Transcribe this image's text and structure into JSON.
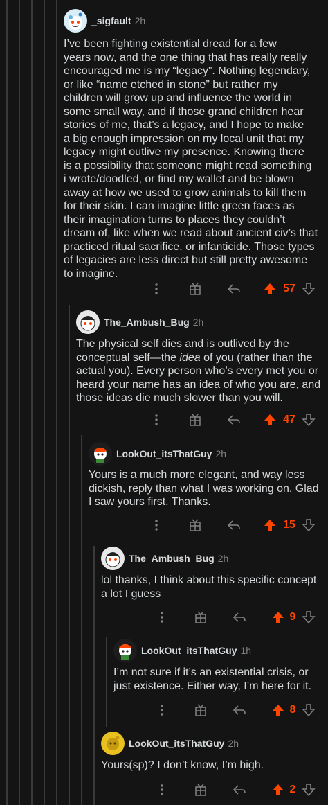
{
  "colors": {
    "background": "#141414",
    "text": "#d7dadc",
    "muted": "#818384",
    "upvote": "#ff4500",
    "thread_line": "#3a3a3c"
  },
  "actions": {
    "more": "more-options-icon",
    "award": "award-icon",
    "reply": "reply-icon",
    "upvote": "upvote-icon",
    "downvote": "downvote-icon"
  },
  "comments": [
    {
      "user": "_sigfault",
      "age": "2h",
      "body": "I’ve been fighting existential dread for a few\nyears now, and the one thing that has really really\nencouraged me is my “legacy”. Nothing legendary,\nor like “name etched in stone” but rather my\nchildren will grow up and influence the world in\nsome small way, and if those grand children hear\nstories of me, that’s a legacy, and I hope to make\na big enough impression on my local unit that my\nlegacy might outlive my presence. Knowing there\nis a possibility that someone might read something\ni wrote/doodled, or find my wallet and be blown\naway at how we used to grow animals to kill them\nfor their skin. I can imagine little green faces as\ntheir imagination turns to places they couldn’t\ndream of, like when we read about ancient civ’s that\npracticed ritual sacrifice, or infanticide. Those types\nof legacies are less direct but still pretty awesome\nto imagine.",
      "score": "57"
    },
    {
      "user": "The_Ambush_Bug",
      "age": "2h",
      "body_before": "The physical self dies and is outlived by the\nconceptual self—the ",
      "body_italic": "idea",
      "body_after": " of you (rather than the\nactual you). Every person who’s every met you or\nheard your name has an idea of who you are, and\nthose ideas die much slower than you will.",
      "score": "47"
    },
    {
      "user": "LookOut_itsThatGuy",
      "age": "2h",
      "body": "Yours is a much more elegant, and way less\ndickish, reply than what I was working on. Glad\nI saw yours first. Thanks.",
      "score": "15"
    },
    {
      "user": "The_Ambush_Bug",
      "age": "2h",
      "body": "lol thanks, I think about this specific concept\na lot I guess",
      "score": "9"
    },
    {
      "user": "LookOut_itsThatGuy",
      "age": "1h",
      "body": "I’m not sure if it’s an existential crisis, or\njust existence. Either way, I’m here for it.",
      "score": "8"
    },
    {
      "user": "LookOut_itsThatGuy",
      "age": "2h",
      "body": "Yours(sp)? I don’t know, I’m high.",
      "score": "2"
    }
  ]
}
